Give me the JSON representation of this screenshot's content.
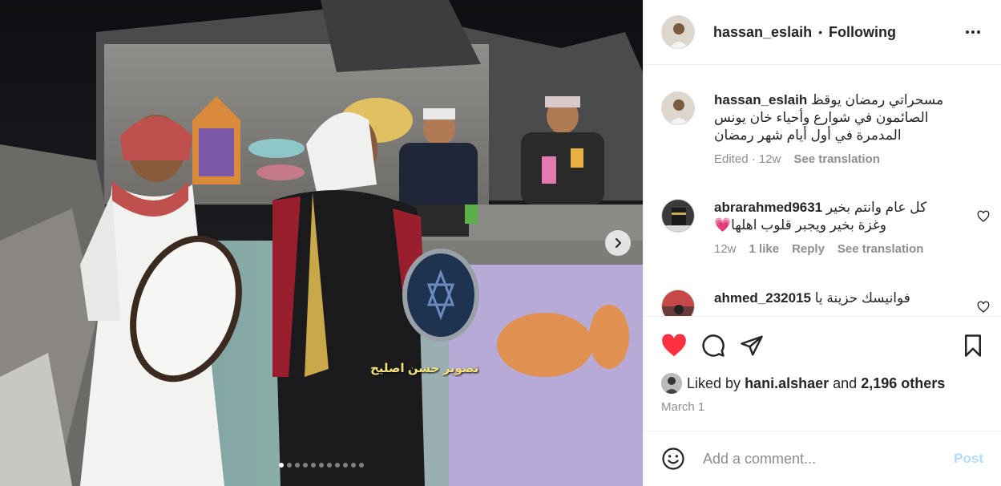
{
  "media": {
    "watermark": "تصوير حسن اصليح",
    "slide_count": 11,
    "active_slide": 1
  },
  "header": {
    "username": "hassan_eslaih",
    "separator": "•",
    "follow_status": "Following"
  },
  "caption": {
    "username": "hassan_eslaih",
    "text": "مسحراتي رمضان يوقظ الصائمون في شوارع وأحياء خان يونس المدمرة في أول أيام شهر رمضان",
    "edited": "Edited · 12w",
    "see_translation": "See translation"
  },
  "comments": [
    {
      "username": "abrarahmed9631",
      "text": "كل عام وانتم بخير وغزة بخير ويجبر قلوب اهلها💗",
      "age": "12w",
      "likes": "1 like",
      "reply": "Reply",
      "see_translation": "See translation"
    },
    {
      "username": "ahmed_232015",
      "text": "فوانيسك حزينة يا"
    }
  ],
  "likes": {
    "prefix": "Liked by",
    "user": "hani.alshaer",
    "conjunction": "and",
    "others": "2,196 others"
  },
  "date": "March 1",
  "add_comment": {
    "placeholder": "Add a comment...",
    "post_label": "Post"
  },
  "colors": {
    "like_red": "#ff3040",
    "post_blue_disabled": "#b3dbff",
    "meta_gray": "#8e8e8e"
  },
  "icons": {
    "like": "heart-filled-icon",
    "comment": "speech-bubble-icon",
    "share": "paper-plane-icon",
    "save": "bookmark-icon",
    "emoji": "smiley-icon",
    "more": "more-horizontal-icon",
    "next": "chevron-right-icon"
  }
}
